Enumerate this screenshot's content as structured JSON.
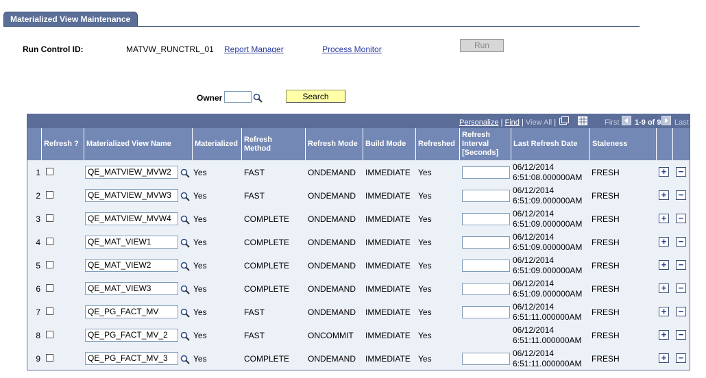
{
  "page": {
    "tab_label": "Materialized View Maintenance",
    "run_control_label": "Run Control ID:",
    "run_control_value": "MATVW_RUNCTRL_01",
    "report_manager": "Report Manager",
    "process_monitor": "Process Monitor",
    "run_label": "Run"
  },
  "filter": {
    "owner_label": "Owner",
    "owner_value": "",
    "search_label": "Search"
  },
  "grid": {
    "personalize": "Personalize",
    "find": "Find",
    "view_all": "View All",
    "first": "First",
    "range": "1-9 of 9",
    "last": "Last",
    "columns": {
      "refresh": "Refresh ?",
      "mv_name": "Materialized View Name",
      "materialized": "Materialized",
      "refresh_method": "Refresh Method",
      "refresh_mode": "Refresh Mode",
      "build_mode": "Build Mode",
      "refreshed": "Refreshed",
      "refresh_interval": "Refresh Interval [Seconds]",
      "last_refresh_date": "Last Refresh Date",
      "staleness": "Staleness"
    },
    "rows": [
      {
        "num": "1",
        "name": "QE_MATVIEW_MVW2",
        "materialized": "Yes",
        "method": "FAST",
        "mode": "ONDEMAND",
        "build": "IMMEDIATE",
        "refreshed": "Yes",
        "has_interval": true,
        "date1": "06/12/2014",
        "date2": "6:51:08.000000AM",
        "staleness": "FRESH"
      },
      {
        "num": "2",
        "name": "QE_MATVIEW_MVW3",
        "materialized": "Yes",
        "method": "FAST",
        "mode": "ONDEMAND",
        "build": "IMMEDIATE",
        "refreshed": "Yes",
        "has_interval": true,
        "date1": "06/12/2014",
        "date2": "6:51:09.000000AM",
        "staleness": "FRESH"
      },
      {
        "num": "3",
        "name": "QE_MATVIEW_MVW4",
        "materialized": "Yes",
        "method": "COMPLETE",
        "mode": "ONDEMAND",
        "build": "IMMEDIATE",
        "refreshed": "Yes",
        "has_interval": true,
        "date1": "06/12/2014",
        "date2": "6:51:09.000000AM",
        "staleness": "FRESH"
      },
      {
        "num": "4",
        "name": "QE_MAT_VIEW1",
        "materialized": "Yes",
        "method": "COMPLETE",
        "mode": "ONDEMAND",
        "build": "IMMEDIATE",
        "refreshed": "Yes",
        "has_interval": true,
        "date1": "06/12/2014",
        "date2": "6:51:09.000000AM",
        "staleness": "FRESH"
      },
      {
        "num": "5",
        "name": "QE_MAT_VIEW2",
        "materialized": "Yes",
        "method": "COMPLETE",
        "mode": "ONDEMAND",
        "build": "IMMEDIATE",
        "refreshed": "Yes",
        "has_interval": true,
        "date1": "06/12/2014",
        "date2": "6:51:09.000000AM",
        "staleness": "FRESH"
      },
      {
        "num": "6",
        "name": "QE_MAT_VIEW3",
        "materialized": "Yes",
        "method": "COMPLETE",
        "mode": "ONDEMAND",
        "build": "IMMEDIATE",
        "refreshed": "Yes",
        "has_interval": true,
        "date1": "06/12/2014",
        "date2": "6:51:09.000000AM",
        "staleness": "FRESH"
      },
      {
        "num": "7",
        "name": "QE_PG_FACT_MV",
        "materialized": "Yes",
        "method": "FAST",
        "mode": "ONDEMAND",
        "build": "IMMEDIATE",
        "refreshed": "Yes",
        "has_interval": true,
        "date1": "06/12/2014",
        "date2": "6:51:11.000000AM",
        "staleness": "FRESH"
      },
      {
        "num": "8",
        "name": "QE_PG_FACT_MV_2",
        "materialized": "Yes",
        "method": "FAST",
        "mode": "ONCOMMIT",
        "build": "IMMEDIATE",
        "refreshed": "Yes",
        "has_interval": false,
        "date1": "06/12/2014",
        "date2": "6:51:11.000000AM",
        "staleness": "FRESH"
      },
      {
        "num": "9",
        "name": "QE_PG_FACT_MV_3",
        "materialized": "Yes",
        "method": "COMPLETE",
        "mode": "ONDEMAND",
        "build": "IMMEDIATE",
        "refreshed": "Yes",
        "has_interval": true,
        "date1": "06/12/2014",
        "date2": "6:51:11.000000AM",
        "staleness": "FRESH"
      }
    ]
  },
  "icons": {
    "lookup": "magnifier-icon",
    "add_row": "plus-icon",
    "delete_row": "minus-icon",
    "download": "grid-download-icon",
    "zoom": "zoom-icon",
    "first_nav": "arrow-left-icon",
    "last_nav": "arrow-right-icon"
  }
}
